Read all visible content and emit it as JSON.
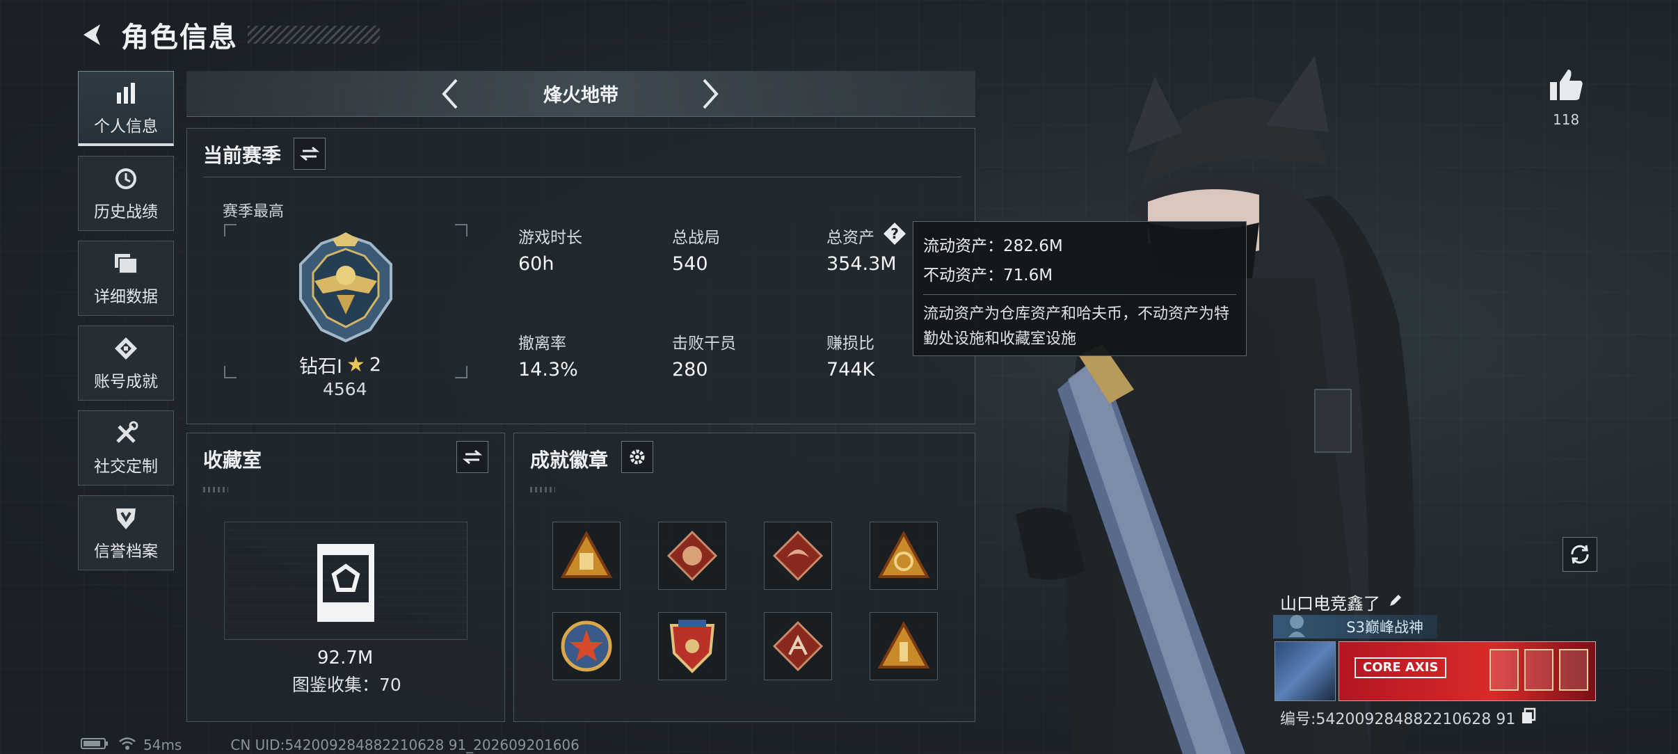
{
  "header": {
    "title": "角色信息"
  },
  "sidebar": {
    "items": [
      {
        "label": "个人信息",
        "icon": "bar-chart-icon",
        "active": true
      },
      {
        "label": "历史战绩",
        "icon": "clock-icon"
      },
      {
        "label": "详细数据",
        "icon": "folder-icon"
      },
      {
        "label": "账号成就",
        "icon": "achievement-icon"
      },
      {
        "label": "社交定制",
        "icon": "tools-icon"
      },
      {
        "label": "信誉档案",
        "icon": "shield-icon"
      }
    ]
  },
  "mode": {
    "label": "烽火地带"
  },
  "season": {
    "title": "当前赛季",
    "best_label": "赛季最高",
    "rank_name": "钻石Ⅰ",
    "rank_stars": "2",
    "rank_score": "4564",
    "stats": [
      {
        "label": "游戏时长",
        "value": "60h"
      },
      {
        "label": "总战局",
        "value": "540"
      },
      {
        "label": "总资产",
        "value": "354.3M"
      },
      {
        "label": "撤离率",
        "value": "14.3%"
      },
      {
        "label": "击败干员",
        "value": "280"
      },
      {
        "label": "赚损比",
        "value": "744K"
      }
    ]
  },
  "tooltip": {
    "liquid": "流动资产：282.6M",
    "fixed": "不动资产：71.6M",
    "desc": "流动资产为仓库资产和哈夫币，不动资产为特勤处设施和收藏室设施"
  },
  "collection": {
    "title": "收藏室",
    "value": "92.7M",
    "count_label": "图鉴收集：70"
  },
  "achievements": {
    "title": "成就徽章",
    "badges": [
      "badge-triangle-icon",
      "badge-beast-icon",
      "badge-dragon-icon",
      "badge-radar-icon",
      "badge-star-icon",
      "badge-crest-icon",
      "badge-runner-icon",
      "badge-tower-icon"
    ]
  },
  "social": {
    "likes": "118"
  },
  "player": {
    "name": "山口电竞鑫了",
    "title_tag": "S3巅峰战神",
    "banner_logo": "CORE AXIS",
    "id_text": "编号:542009284882210628 91"
  },
  "status": {
    "ping": "54ms",
    "uid": "CN UID:542009284882210628 91_202609201606"
  },
  "colors": {
    "accent": "#e9c45a",
    "panel": "#20272d",
    "border": "#4b5760",
    "banner": "#d92a2a"
  }
}
